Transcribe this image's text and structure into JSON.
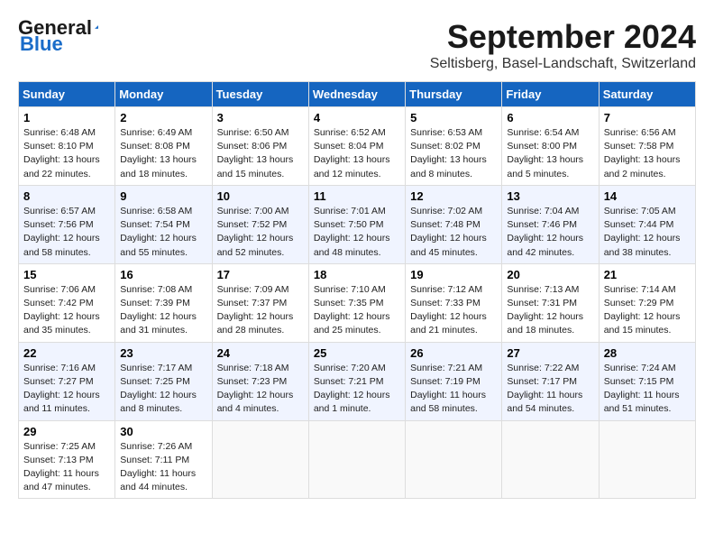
{
  "header": {
    "logo_line1": "General",
    "logo_line2": "Blue",
    "month_title": "September 2024",
    "location": "Seltisberg, Basel-Landschaft, Switzerland"
  },
  "weekdays": [
    "Sunday",
    "Monday",
    "Tuesday",
    "Wednesday",
    "Thursday",
    "Friday",
    "Saturday"
  ],
  "weeks": [
    [
      {
        "day": "1",
        "info": "Sunrise: 6:48 AM\nSunset: 8:10 PM\nDaylight: 13 hours\nand 22 minutes."
      },
      {
        "day": "2",
        "info": "Sunrise: 6:49 AM\nSunset: 8:08 PM\nDaylight: 13 hours\nand 18 minutes."
      },
      {
        "day": "3",
        "info": "Sunrise: 6:50 AM\nSunset: 8:06 PM\nDaylight: 13 hours\nand 15 minutes."
      },
      {
        "day": "4",
        "info": "Sunrise: 6:52 AM\nSunset: 8:04 PM\nDaylight: 13 hours\nand 12 minutes."
      },
      {
        "day": "5",
        "info": "Sunrise: 6:53 AM\nSunset: 8:02 PM\nDaylight: 13 hours\nand 8 minutes."
      },
      {
        "day": "6",
        "info": "Sunrise: 6:54 AM\nSunset: 8:00 PM\nDaylight: 13 hours\nand 5 minutes."
      },
      {
        "day": "7",
        "info": "Sunrise: 6:56 AM\nSunset: 7:58 PM\nDaylight: 13 hours\nand 2 minutes."
      }
    ],
    [
      {
        "day": "8",
        "info": "Sunrise: 6:57 AM\nSunset: 7:56 PM\nDaylight: 12 hours\nand 58 minutes."
      },
      {
        "day": "9",
        "info": "Sunrise: 6:58 AM\nSunset: 7:54 PM\nDaylight: 12 hours\nand 55 minutes."
      },
      {
        "day": "10",
        "info": "Sunrise: 7:00 AM\nSunset: 7:52 PM\nDaylight: 12 hours\nand 52 minutes."
      },
      {
        "day": "11",
        "info": "Sunrise: 7:01 AM\nSunset: 7:50 PM\nDaylight: 12 hours\nand 48 minutes."
      },
      {
        "day": "12",
        "info": "Sunrise: 7:02 AM\nSunset: 7:48 PM\nDaylight: 12 hours\nand 45 minutes."
      },
      {
        "day": "13",
        "info": "Sunrise: 7:04 AM\nSunset: 7:46 PM\nDaylight: 12 hours\nand 42 minutes."
      },
      {
        "day": "14",
        "info": "Sunrise: 7:05 AM\nSunset: 7:44 PM\nDaylight: 12 hours\nand 38 minutes."
      }
    ],
    [
      {
        "day": "15",
        "info": "Sunrise: 7:06 AM\nSunset: 7:42 PM\nDaylight: 12 hours\nand 35 minutes."
      },
      {
        "day": "16",
        "info": "Sunrise: 7:08 AM\nSunset: 7:39 PM\nDaylight: 12 hours\nand 31 minutes."
      },
      {
        "day": "17",
        "info": "Sunrise: 7:09 AM\nSunset: 7:37 PM\nDaylight: 12 hours\nand 28 minutes."
      },
      {
        "day": "18",
        "info": "Sunrise: 7:10 AM\nSunset: 7:35 PM\nDaylight: 12 hours\nand 25 minutes."
      },
      {
        "day": "19",
        "info": "Sunrise: 7:12 AM\nSunset: 7:33 PM\nDaylight: 12 hours\nand 21 minutes."
      },
      {
        "day": "20",
        "info": "Sunrise: 7:13 AM\nSunset: 7:31 PM\nDaylight: 12 hours\nand 18 minutes."
      },
      {
        "day": "21",
        "info": "Sunrise: 7:14 AM\nSunset: 7:29 PM\nDaylight: 12 hours\nand 15 minutes."
      }
    ],
    [
      {
        "day": "22",
        "info": "Sunrise: 7:16 AM\nSunset: 7:27 PM\nDaylight: 12 hours\nand 11 minutes."
      },
      {
        "day": "23",
        "info": "Sunrise: 7:17 AM\nSunset: 7:25 PM\nDaylight: 12 hours\nand 8 minutes."
      },
      {
        "day": "24",
        "info": "Sunrise: 7:18 AM\nSunset: 7:23 PM\nDaylight: 12 hours\nand 4 minutes."
      },
      {
        "day": "25",
        "info": "Sunrise: 7:20 AM\nSunset: 7:21 PM\nDaylight: 12 hours\nand 1 minute."
      },
      {
        "day": "26",
        "info": "Sunrise: 7:21 AM\nSunset: 7:19 PM\nDaylight: 11 hours\nand 58 minutes."
      },
      {
        "day": "27",
        "info": "Sunrise: 7:22 AM\nSunset: 7:17 PM\nDaylight: 11 hours\nand 54 minutes."
      },
      {
        "day": "28",
        "info": "Sunrise: 7:24 AM\nSunset: 7:15 PM\nDaylight: 11 hours\nand 51 minutes."
      }
    ],
    [
      {
        "day": "29",
        "info": "Sunrise: 7:25 AM\nSunset: 7:13 PM\nDaylight: 11 hours\nand 47 minutes."
      },
      {
        "day": "30",
        "info": "Sunrise: 7:26 AM\nSunset: 7:11 PM\nDaylight: 11 hours\nand 44 minutes."
      },
      {
        "day": "",
        "info": ""
      },
      {
        "day": "",
        "info": ""
      },
      {
        "day": "",
        "info": ""
      },
      {
        "day": "",
        "info": ""
      },
      {
        "day": "",
        "info": ""
      }
    ]
  ]
}
